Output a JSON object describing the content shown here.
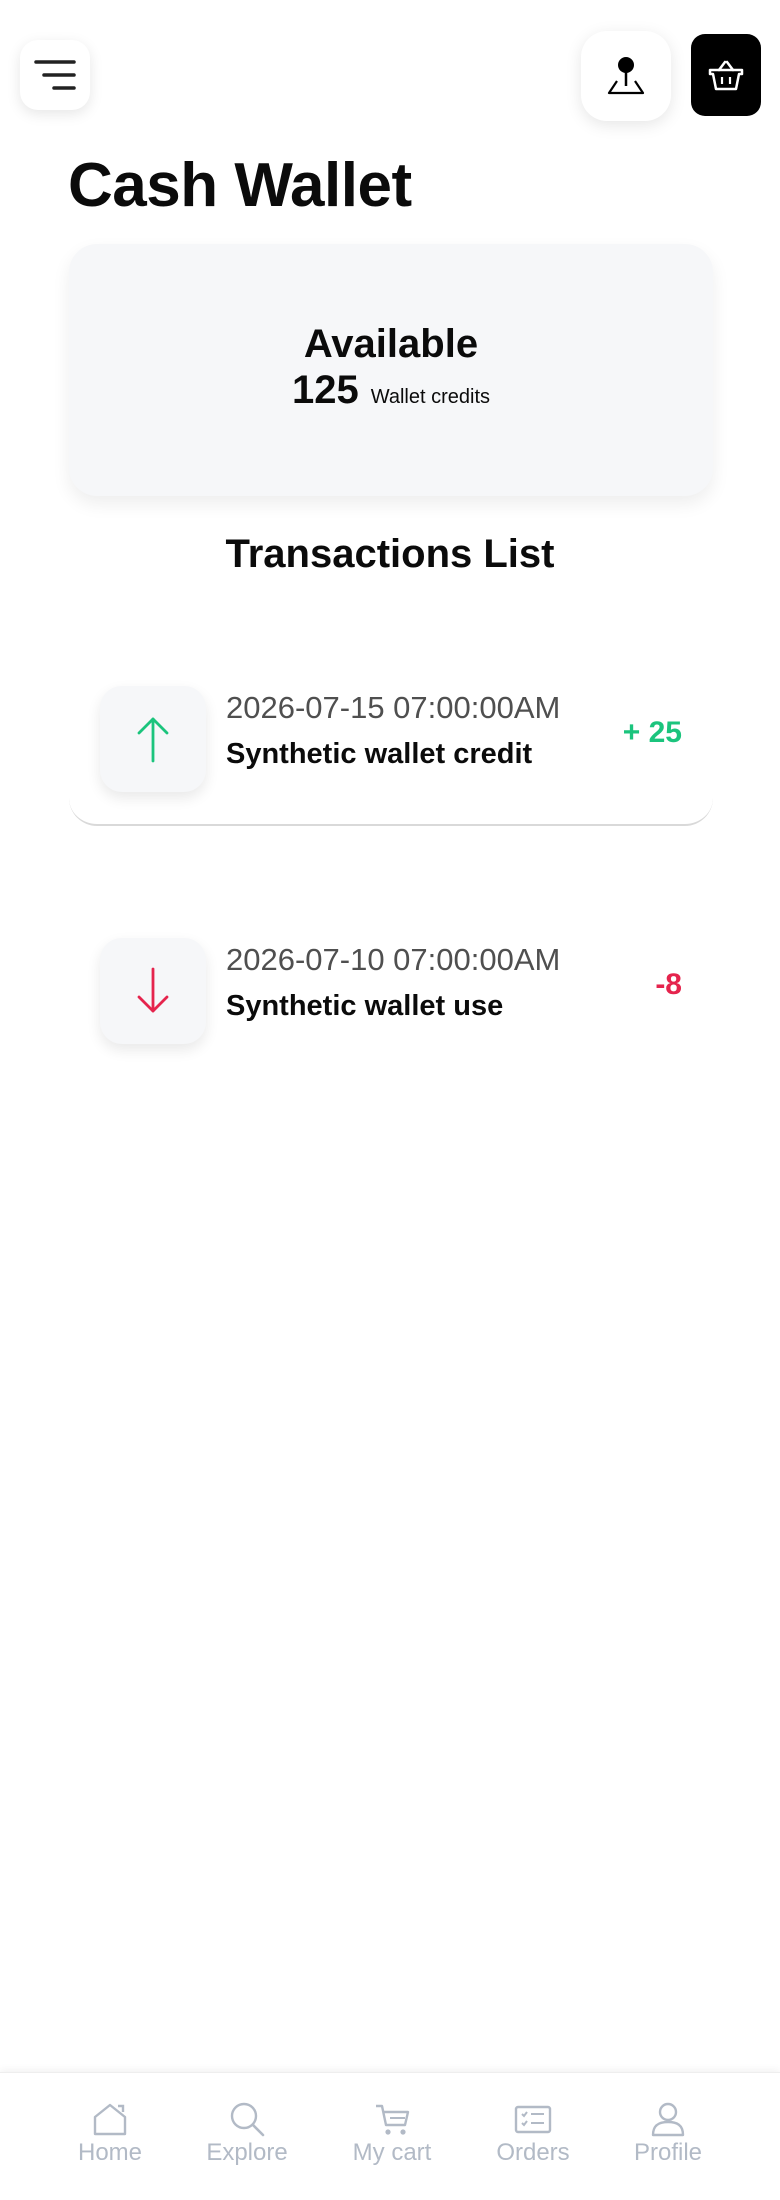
{
  "header": {
    "title": "Cash Wallet",
    "icons": {
      "menu": "menu-icon",
      "location": "map-pin-icon",
      "basket": "basket-icon"
    }
  },
  "wallet": {
    "available_label": "Available",
    "balance": "125",
    "unit": "Wallet credits"
  },
  "transactions": {
    "heading": "Transactions List",
    "items": [
      {
        "date": "2026-07-15 07:00:00AM",
        "description": "Synthetic wallet credit",
        "amount": "+ 25",
        "direction": "credit",
        "icon": "arrow-up-icon",
        "color": "#1bc47d"
      },
      {
        "date": "2026-07-10 07:00:00AM",
        "description": "Synthetic wallet use",
        "amount": "-8",
        "direction": "debit",
        "icon": "arrow-down-icon",
        "color": "#e5244d"
      }
    ]
  },
  "nav": {
    "items": [
      {
        "label": "Home",
        "icon": "home-icon"
      },
      {
        "label": "Explore",
        "icon": "search-icon"
      },
      {
        "label": "My cart",
        "icon": "cart-icon"
      },
      {
        "label": "Orders",
        "icon": "orders-icon"
      },
      {
        "label": "Profile",
        "icon": "profile-icon"
      }
    ],
    "color": "#b2bac6"
  }
}
